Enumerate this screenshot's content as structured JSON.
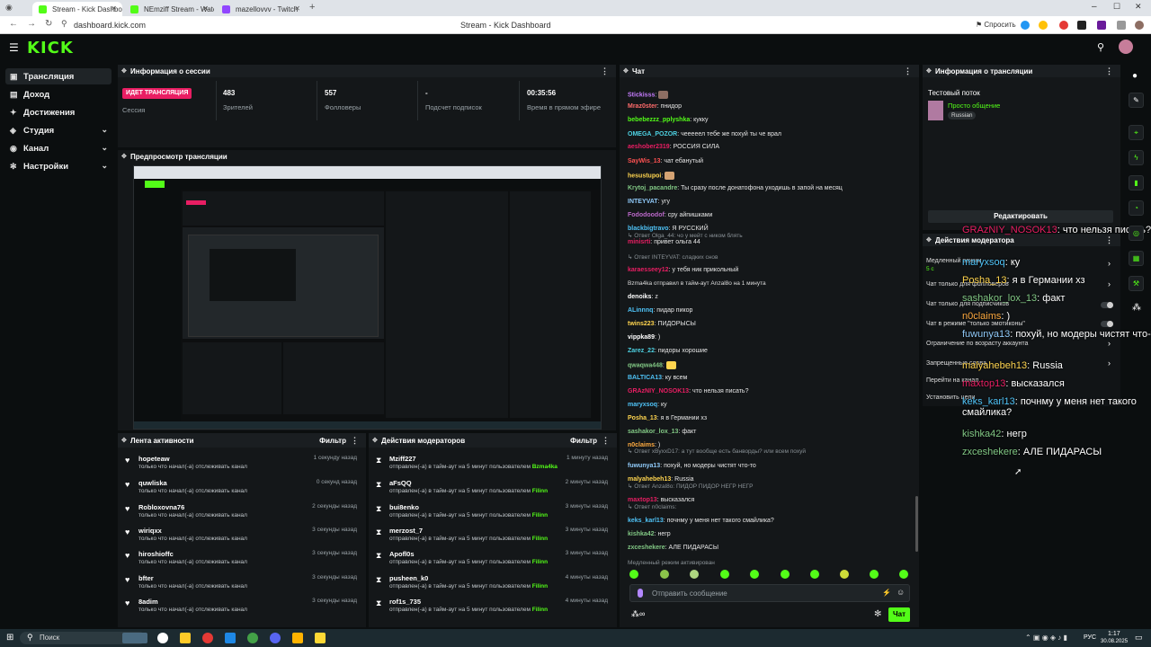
{
  "browser": {
    "tabs": [
      {
        "label": "Stream - Kick Dashboa",
        "color": "#53fc18"
      },
      {
        "label": "NEmziff Stream - Watch L",
        "color": "#53fc18"
      },
      {
        "label": "mazellovvv - Twitch",
        "color": "#9146ff"
      }
    ],
    "url": "dashboard.kick.com",
    "page_title": "Stream - Kick Dashboard",
    "translate_label": "Спросить"
  },
  "header": {
    "logo": "KICK"
  },
  "sidebar": {
    "items": [
      {
        "label": "Трансляция",
        "icon": "broadcast-icon"
      },
      {
        "label": "Доход",
        "icon": "wallet-icon"
      },
      {
        "label": "Достижения",
        "icon": "trophy-icon"
      },
      {
        "label": "Студия",
        "icon": "studio-icon"
      },
      {
        "label": "Канал",
        "icon": "channel-icon"
      },
      {
        "label": "Настройки",
        "icon": "gear-icon"
      }
    ]
  },
  "session": {
    "title": "Информация о сессии",
    "live_button": "ИДЕТ ТРАНСЛЯЦИЯ",
    "session_label": "Сессия",
    "stats": [
      {
        "value": "483",
        "label": "Зрителей"
      },
      {
        "value": "557",
        "label": "Фолловеры"
      },
      {
        "value": "-",
        "label": "Подсчет подписок"
      },
      {
        "value": "00:35:56",
        "label": "Время в прямом эфире"
      }
    ]
  },
  "preview": {
    "title": "Предпросмотр трансляции"
  },
  "activity": {
    "title": "Лента активности",
    "filter": "Фильтр",
    "items": [
      {
        "name": "hopeteaw",
        "sub": "только что начал(-а) отслеживать канал",
        "time": "1 секунду назад"
      },
      {
        "name": "quwliska",
        "sub": "только что начал(-а) отслеживать канал",
        "time": "0 секунд назад"
      },
      {
        "name": "Robloxovna76",
        "sub": "только что начал(-а) отслеживать канал",
        "time": "2 секунды назад"
      },
      {
        "name": "wiriqxx",
        "sub": "только что начал(-а) отслеживать канал",
        "time": "3 секунды назад"
      },
      {
        "name": "hiroshioffc",
        "sub": "только что начал(-а) отслеживать канал",
        "time": "3 секунды назад"
      },
      {
        "name": "bfter",
        "sub": "только что начал(-а) отслеживать канал",
        "time": "3 секунды назад"
      },
      {
        "name": "8adim",
        "sub": "только что начал(-а) отслеживать канал",
        "time": "3 секунды назад"
      }
    ]
  },
  "modactions": {
    "title": "Действия модераторов",
    "filter": "Фильтр",
    "items": [
      {
        "name": "Mziff227",
        "sub": "отправлен(-а) в тайм-аут на 5 минут пользователем",
        "by": "Bzma4ka",
        "time": "1 минуту назад"
      },
      {
        "name": "aFsQQ",
        "sub": "отправлен(-а) в тайм-аут на 5 минут пользователем",
        "by": "Filinn",
        "time": "2 минуты назад"
      },
      {
        "name": "bui8enko",
        "sub": "отправлен(-а) в тайм-аут на 5 минут пользователем",
        "by": "Filinn",
        "time": "3 минуты назад"
      },
      {
        "name": "merzost_7",
        "sub": "отправлен(-а) в тайм-аут на 5 минут пользователем",
        "by": "Filinn",
        "time": "3 минуты назад"
      },
      {
        "name": "Apofl0s",
        "sub": "отправлен(-а) в тайм-аут на 5 минут пользователем",
        "by": "Filinn",
        "time": "3 минуты назад"
      },
      {
        "name": "pusheen_k0",
        "sub": "отправлен(-а) в тайм-аут на 5 минут пользователем",
        "by": "Filinn",
        "time": "4 минуты назад"
      },
      {
        "name": "rof1s_735",
        "sub": "отправлен(-а) в тайм-аут на 5 минут пользователем",
        "by": "Filinn",
        "time": "4 минуты назад"
      }
    ]
  },
  "chat": {
    "title": "Чат",
    "messages": [
      {
        "user": "Stickisss",
        "color": "#c77dff",
        "text": ""
      },
      {
        "user": "Mraz0ster",
        "color": "#ff6b6b",
        "text": "пнидор"
      },
      {
        "user": "bebebezzz_pplyshka",
        "color": "#53fc18",
        "text": "кукку"
      },
      {
        "user": "OMEGA_POZOR",
        "color": "#4dd0e1",
        "text": "чееееел тебе же похуй ты че врал"
      },
      {
        "user": "aeshober2319",
        "color": "#e91e63",
        "text": "РОССИЯ СИЛА"
      },
      {
        "user": "SayWis_13",
        "color": "#ff5252",
        "text": "чат ебанутый"
      },
      {
        "user": "hesustupoi",
        "color": "#ffd54f",
        "text": ""
      },
      {
        "user": "Krytoj_pacandre",
        "color": "#81c784",
        "text": "Ты сразу после донатофона уходишь в запой на месяц"
      },
      {
        "user": "INTEYVAT",
        "color": "#90caf9",
        "text": "угу"
      },
      {
        "user": "Fododoodof",
        "color": "#ba68c8",
        "text": "сру айпишками"
      },
      {
        "user": "blackbigtravo",
        "color": "#4fc3f7",
        "text": "Я РУССКИЙ"
      },
      {
        "user": "minisrti",
        "color": "#e91e63",
        "text": "привет ольга 44"
      },
      {
        "user": "karaesseey12",
        "color": "#e91e63",
        "text": "у тебя ник прикольный"
      },
      {
        "user": "denoiks",
        "color": "#ffffff",
        "text": "z"
      },
      {
        "user": "ALinnnq",
        "color": "#4fc3f7",
        "text": "пидар пикор"
      },
      {
        "user": "twins223",
        "color": "#ffd54f",
        "text": "ПИДОРЫСЫ"
      },
      {
        "user": "vippka89",
        "color": "#ffffff",
        "text": ")"
      },
      {
        "user": "Zarez_22",
        "color": "#4dd0e1",
        "text": "пидоры хорошие"
      },
      {
        "user": "qwaqwa448",
        "color": "#81c784",
        "text": ""
      },
      {
        "user": "BALTICA13",
        "color": "#4fc3f7",
        "text": "ку всем"
      },
      {
        "user": "GRAzNIY_NOSOK13",
        "color": "#e91e63",
        "text": "что нельзя писать?"
      },
      {
        "user": "maryxsoq",
        "color": "#4fc3f7",
        "text": "ку"
      },
      {
        "user": "Posha_13",
        "color": "#ffd54f",
        "text": "я в Германии хз"
      },
      {
        "user": "sashakor_lox_13",
        "color": "#81c784",
        "text": "факт"
      },
      {
        "user": "n0claims",
        "color": "#ffab40",
        "text": ")"
      },
      {
        "user": "fuwunya13",
        "color": "#90caf9",
        "text": "похуй, но модеры чистят что-то"
      },
      {
        "user": "malyahebeh13",
        "color": "#ffd54f",
        "text": "Russia"
      },
      {
        "user": "maxtop13",
        "color": "#e91e63",
        "text": "высказался"
      },
      {
        "user": "keks_karl13",
        "color": "#4fc3f7",
        "text": "почнму у меня нет такого смайлика?"
      },
      {
        "user": "kishka42",
        "color": "#81c784",
        "text": "негр"
      },
      {
        "user": "zxceshekere",
        "color": "#81c784",
        "text": "АЛЕ ПИДАРАСЫ"
      }
    ],
    "replies": [
      "Ответ Olga_44: чо у мейт с ником блять",
      "Ответ INTEYVAT: сладких снов",
      "Ответ xByxxD17: а тут вообще есть банворды? или всем похуй",
      "Ответ Anzal8o: ПИДОР ПИДОР НЕГР НЕГР",
      "Ответ n0claims:"
    ],
    "timeout_notice": "Bzma4ka отправил в тайм-аут Anzal8o на 1 минута",
    "slow_mode": "Медленный режим активирован",
    "input_placeholder": "Отправить сообщение",
    "send_button": "Чат"
  },
  "stream_info": {
    "title": "Информация о трансляции",
    "stream_title": "Тестовый поток",
    "category": "Просто общение",
    "tag": "Russian",
    "edit_button": "Редактировать"
  },
  "mod_settings": {
    "title": "Действия модератора",
    "rows": [
      "Медленный режим",
      "Чат только для фолловеров",
      "Чат только для подписчиков",
      "Чат в режиме \"только эмотиконы\"",
      "Ограничение по возрасту аккаунта",
      "Запрещенные слова",
      "Перейти на канал",
      "Установить цели"
    ],
    "slow_sub": "5 с"
  },
  "overlay_chat": [
    {
      "user": "GRAzNIY_NOSOK13",
      "color": "#e91e63",
      "text": "что нельзя писать?"
    },
    {
      "user": "maryxsoq",
      "color": "#4fc3f7",
      "text": "ку"
    },
    {
      "user": "Posha_13",
      "color": "#ffd54f",
      "text": "я в Германии хз"
    },
    {
      "user": "sashakor_lox_13",
      "color": "#81c784",
      "text": "факт"
    },
    {
      "user": "n0claims",
      "color": "#ffab40",
      "text": ")"
    },
    {
      "user": "fuwunya13",
      "color": "#90caf9",
      "text": "похуй, но модеры чистят что-то"
    },
    {
      "user": "malyahebeh13",
      "color": "#ffd54f",
      "text": "Russia"
    },
    {
      "user": "maxtop13",
      "color": "#e91e63",
      "text": "высказался"
    },
    {
      "user": "keks_karl13",
      "color": "#4fc3f7",
      "text": "почнму у меня нет такого смайлика?"
    },
    {
      "user": "kishka42",
      "color": "#81c784",
      "text": "негр"
    },
    {
      "user": "zxceshekere",
      "color": "#81c784",
      "text": "АЛЕ ПИДАРАСЫ"
    }
  ],
  "taskbar": {
    "search": "Поиск",
    "lang": "РУС",
    "time": "1:17",
    "date": "30.08.2025"
  },
  "colors": {
    "brand": "#53fc18",
    "live": "#e91e63",
    "panel": "#141719"
  }
}
